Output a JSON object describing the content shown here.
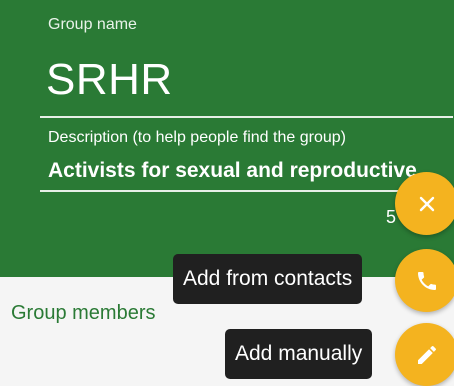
{
  "header": {
    "group_name_label": "Group name",
    "group_name_value": "SRHR",
    "description_label": "Description (to help people find the group)",
    "description_value": "Activists for sexual and reproductive h",
    "char_count": "5"
  },
  "members": {
    "title": "Group members"
  },
  "fab_menu": {
    "add_contacts_label": "Add from contacts",
    "add_manual_label": "Add manually"
  },
  "colors": {
    "header_green": "#2a7a35",
    "fab_yellow": "#f4b31f",
    "text_green": "#2a7a35",
    "tooltip_bg": "#202020"
  },
  "icons": {
    "close": "close-icon",
    "phone": "phone-icon",
    "pencil": "pencil-icon"
  }
}
